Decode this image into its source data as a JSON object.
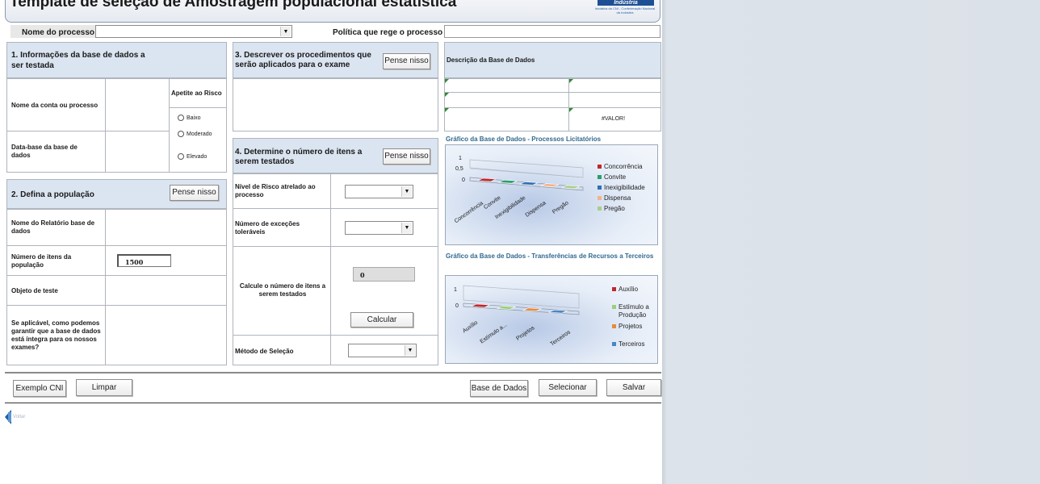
{
  "title": "Template de seleção de Amostragem populacional estatística",
  "logo": {
    "mark": "Indústria",
    "sub": "Iniciativa da CNI - Confederação Nacional da Indústria"
  },
  "top": {
    "process_label": "Nome do processo",
    "policy_label": "Política que rege o processo"
  },
  "section1": {
    "title": "1. Informações da base de dados a ser testada",
    "appetite_label": "Apetite ao Risco",
    "account_label": "Nome da conta ou processo",
    "date_label": "Data-base da base de dados",
    "risk_options": [
      "Baixo",
      "Moderado",
      "Elevado"
    ]
  },
  "section2": {
    "title": "2. Defina a população",
    "button": "Pense nisso",
    "report_label": "Nome do Relatório base de dados",
    "items_label": "Número de itens da população",
    "items_value": "1500",
    "object_label": "Objeto de teste",
    "integrity_label": "Se aplicável, como podemos garantir que a base de dados está íntegra para os nossos exames?"
  },
  "section3": {
    "title": "3. Descrever os procedimentos que serão aplicados para o exame",
    "button": "Pense nisso"
  },
  "section4": {
    "title": "4. Determine o número de itens a serem testados",
    "button": "Pense nisso",
    "risk_label": "Nível de Risco atrelado ao processo",
    "exceptions_label": "Número de exceções toleráveis",
    "calc_label": "Calcule o número de itens a serem testados",
    "result_value": "0",
    "calc_button": "Calcular",
    "method_label": "Método de Seleção"
  },
  "database": {
    "title": "Descrição da Base de Dados",
    "error_value": "#VALOR!"
  },
  "charts_meta": {
    "chart1_title": "Gráfico da Base de Dados - Processos Licitatórios",
    "chart2_title": "Gráfico da Base de Dados - Transferências de Recursos a Terceiros"
  },
  "chart_data": [
    {
      "type": "bar",
      "title": "Gráfico da Base de Dados - Processos Licitatórios",
      "categories": [
        "Concorrência",
        "Convite",
        "Inexigibilidade",
        "Dispensa",
        "Pregão"
      ],
      "yticks": [
        "1",
        "0,5",
        "0"
      ],
      "ylim": [
        0,
        1
      ],
      "values": [
        0,
        0,
        0,
        0,
        0
      ],
      "colors": [
        "#c0272d",
        "#2a9d6a",
        "#2f6fb5",
        "#f2b48c",
        "#a8cf8a"
      ],
      "legend": [
        "Concorrência",
        "Convite",
        "Inexigibilidade",
        "Dispensa",
        "Pregão"
      ]
    },
    {
      "type": "bar",
      "title": "Gráfico da Base de Dados - Transferências de Recursos a Terceiros",
      "categories": [
        "Auxílio",
        "Estímulo a...",
        "Projetos",
        "Terceiros"
      ],
      "yticks": [
        "1",
        "0"
      ],
      "ylim": [
        0,
        1
      ],
      "values": [
        0,
        0,
        0,
        0
      ],
      "colors": [
        "#c0272d",
        "#9bcf7a",
        "#e8893d",
        "#4a86c4"
      ],
      "legend": [
        "Auxílio",
        "Estímulo a Produção",
        "Projetos",
        "Terceiros"
      ]
    }
  ],
  "bottom_buttons": {
    "example": "Exemplo CNI",
    "clear": "Limpar",
    "database": "Base de Dados",
    "select": "Selecionar",
    "save": "Salvar"
  },
  "back_link": "Voltar"
}
